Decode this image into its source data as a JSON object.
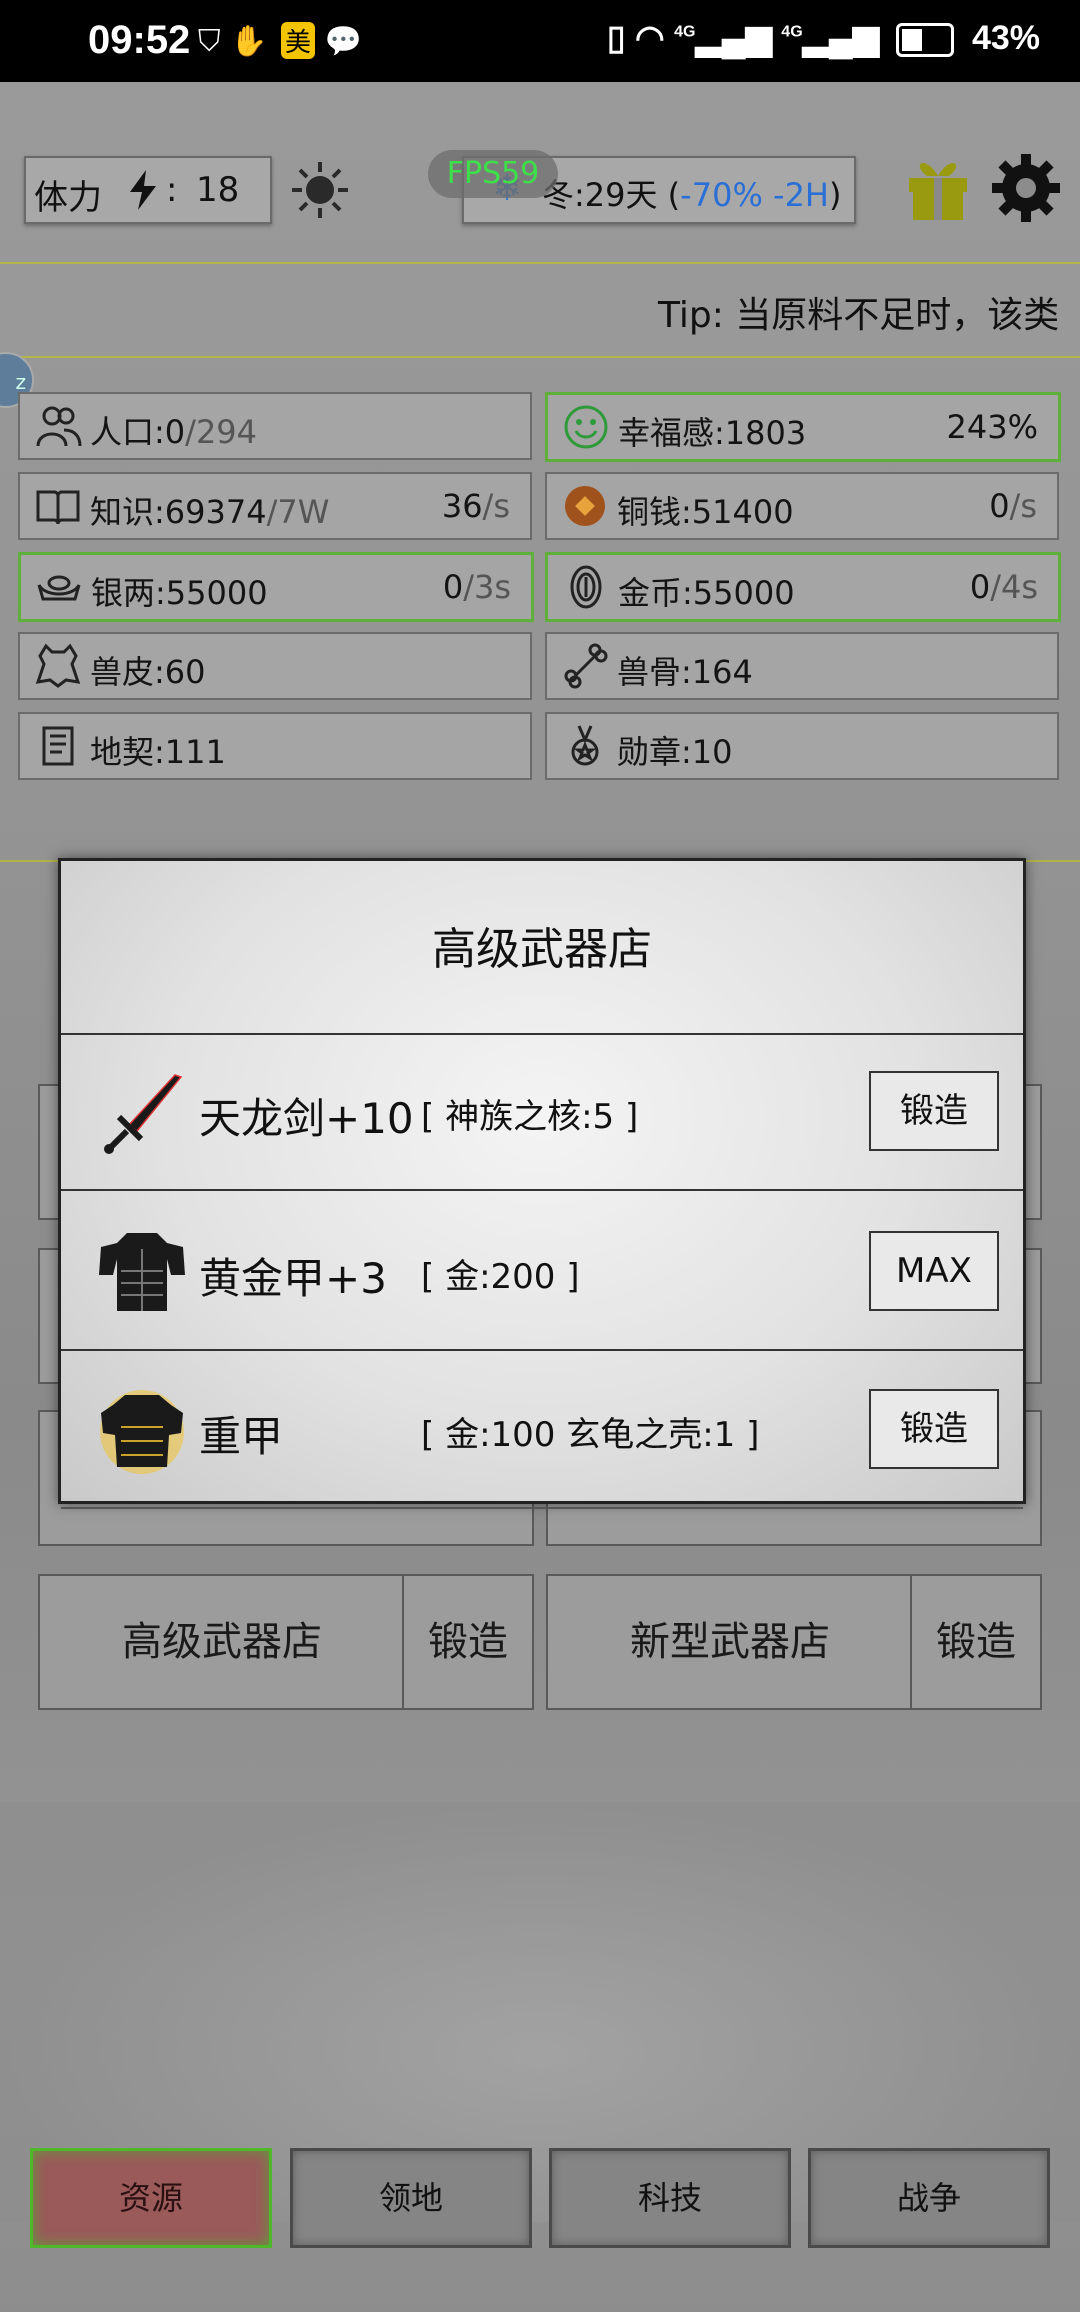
{
  "status_bar": {
    "time": "09:52",
    "mei_badge": "美",
    "signal1": "4G",
    "signal2": "4G",
    "battery": "43%"
  },
  "top": {
    "stamina_label": "体力",
    "stamina_sep": ":",
    "stamina_value": "18",
    "fps": "FPS59",
    "season_text": "冬:29天 (",
    "season_mod": "-70% -2H",
    "season_close": ")"
  },
  "tip": "Tip:  当原料不足时，该类",
  "bubble": "z",
  "stats": [
    {
      "label": "人口:0",
      "dim": "/294",
      "rate": "",
      "rate_dim": ""
    },
    {
      "label": "幸福感:1803",
      "dim": "",
      "rate": "243%",
      "rate_dim": ""
    },
    {
      "label": "知识:69374",
      "dim": "/7W",
      "rate": "36",
      "rate_dim": "/s"
    },
    {
      "label": "铜钱:51400",
      "dim": "",
      "rate": "0",
      "rate_dim": "/s"
    },
    {
      "label": "银两:55000",
      "dim": "",
      "rate": "0",
      "rate_dim": "/3s"
    },
    {
      "label": "金币:55000",
      "dim": "",
      "rate": "0",
      "rate_dim": "/4s"
    },
    {
      "label": "兽皮:60",
      "dim": "",
      "rate": "",
      "rate_dim": ""
    },
    {
      "label": "兽骨:164",
      "dim": "",
      "rate": "",
      "rate_dim": ""
    },
    {
      "label": "地契:111",
      "dim": "",
      "rate": "",
      "rate_dim": ""
    },
    {
      "label": "勋章:10",
      "dim": "",
      "rate": "",
      "rate_dim": ""
    }
  ],
  "shops": [
    {
      "name": "高级武器店",
      "action": "锻造"
    },
    {
      "name": "新型武器店",
      "action": "锻造"
    }
  ],
  "dialog": {
    "title": "高级武器店",
    "items": [
      {
        "name": "天龙剑+10",
        "cost": "[ 神族之核:5 ]",
        "action": "锻造"
      },
      {
        "name": "黄金甲+3",
        "cost": "[ 金:200 ]",
        "action": "MAX"
      },
      {
        "name": "重甲",
        "cost": "[ 金:100  玄龟之壳:1 ]",
        "action": "锻造"
      }
    ]
  },
  "nav": [
    {
      "label": "资源"
    },
    {
      "label": "领地"
    },
    {
      "label": "科技"
    },
    {
      "label": "战争"
    }
  ],
  "colors": {
    "fps": "#3ee04a",
    "season_mod": "#2a6fd6",
    "green_border": "#5fb03a",
    "gift": "#9a9a10"
  }
}
